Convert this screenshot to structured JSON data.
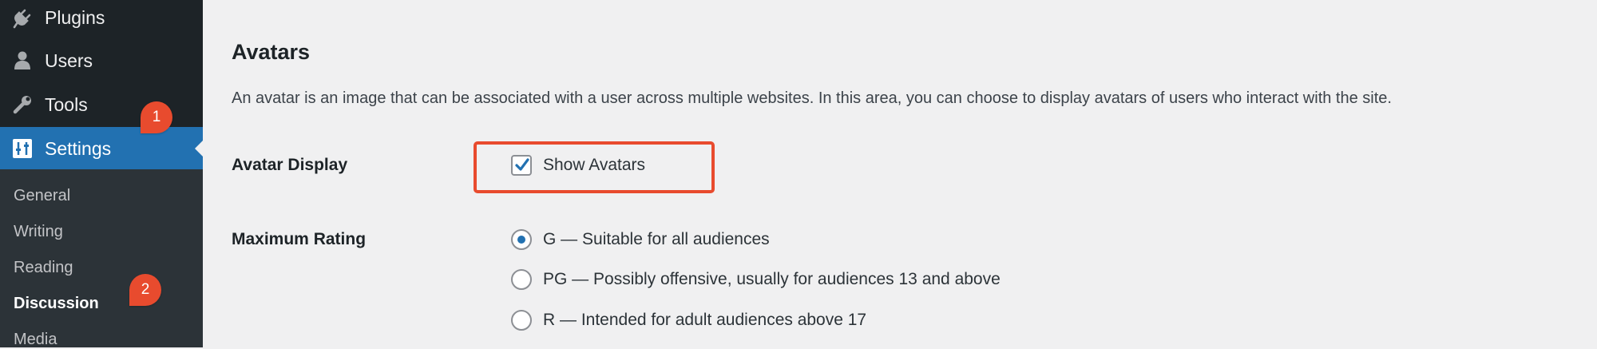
{
  "sidebar": {
    "menu": [
      {
        "label": "Plugins",
        "icon": "plugin-icon"
      },
      {
        "label": "Users",
        "icon": "user-icon"
      },
      {
        "label": "Tools",
        "icon": "wrench-icon"
      },
      {
        "label": "Settings",
        "icon": "settings-icon",
        "active": true
      }
    ],
    "submenu": [
      {
        "label": "General"
      },
      {
        "label": "Writing"
      },
      {
        "label": "Reading"
      },
      {
        "label": "Discussion",
        "current": true
      },
      {
        "label": "Media"
      }
    ]
  },
  "markers": [
    "1",
    "2"
  ],
  "main": {
    "section_title": "Avatars",
    "description": "An avatar is an image that can be associated with a user across multiple websites. In this area, you can choose to display avatars of users who interact with the site.",
    "avatar_display": {
      "label": "Avatar Display",
      "checkbox_label": "Show Avatars",
      "checked": true
    },
    "max_rating": {
      "label": "Maximum Rating",
      "options": [
        {
          "label": "G — Suitable for all audiences",
          "checked": true
        },
        {
          "label": "PG — Possibly offensive, usually for audiences 13 and above",
          "checked": false
        },
        {
          "label": "R — Intended for adult audiences above 17",
          "checked": false
        }
      ]
    }
  },
  "colors": {
    "sidebar_bg": "#1d2327",
    "submenu_bg": "#2c3338",
    "active_bg": "#2271b1",
    "marker": "#e84b2e",
    "highlight": "#e84b2e",
    "content_bg": "#f0f0f1"
  }
}
